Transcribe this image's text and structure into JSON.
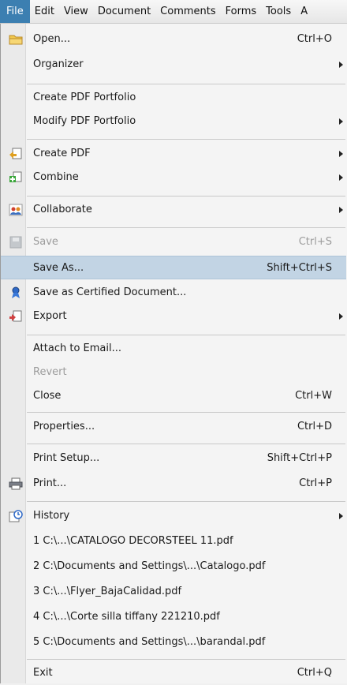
{
  "menubar": [
    "File",
    "Edit",
    "View",
    "Document",
    "Comments",
    "Forms",
    "Tools",
    "A"
  ],
  "items": [
    {
      "label": "Open...",
      "shortcut": "Ctrl+O",
      "icon": "folder-icon"
    },
    {
      "label": "Organizer",
      "submenu": true
    },
    {
      "label": "Create PDF Portfolio"
    },
    {
      "label": "Modify PDF Portfolio",
      "submenu": true
    },
    {
      "label": "Create PDF",
      "submenu": true,
      "icon": "create-pdf-icon"
    },
    {
      "label": "Combine",
      "submenu": true,
      "icon": "combine-icon"
    },
    {
      "label": "Collaborate",
      "submenu": true,
      "icon": "collaborate-icon"
    },
    {
      "label": "Save",
      "shortcut": "Ctrl+S",
      "icon": "save-icon",
      "disabled": true
    },
    {
      "label": "Save As...",
      "shortcut": "Shift+Ctrl+S",
      "highlighted": true
    },
    {
      "label": "Save as Certified Document...",
      "icon": "certified-ribbon-icon"
    },
    {
      "label": "Export",
      "submenu": true,
      "icon": "export-icon"
    },
    {
      "label": "Attach to Email..."
    },
    {
      "label": "Revert",
      "disabled": true
    },
    {
      "label": "Close",
      "shortcut": "Ctrl+W"
    },
    {
      "label": "Properties...",
      "shortcut": "Ctrl+D"
    },
    {
      "label": "Print Setup...",
      "shortcut": "Shift+Ctrl+P"
    },
    {
      "label": "Print...",
      "shortcut": "Ctrl+P",
      "icon": "printer-icon"
    },
    {
      "label": "History",
      "submenu": true,
      "icon": "history-icon"
    },
    {
      "label": "1 C:\\...\\CATALOGO DECORSTEEL 11.pdf"
    },
    {
      "label": "2 C:\\Documents and Settings\\...\\Catalogo.pdf"
    },
    {
      "label": "3 C:\\...\\Flyer_BajaCalidad.pdf"
    },
    {
      "label": "4 C:\\...\\Corte silla tiffany 221210.pdf"
    },
    {
      "label": "5 C:\\Documents and Settings\\...\\barandal.pdf"
    },
    {
      "label": "Exit",
      "shortcut": "Ctrl+Q"
    }
  ]
}
